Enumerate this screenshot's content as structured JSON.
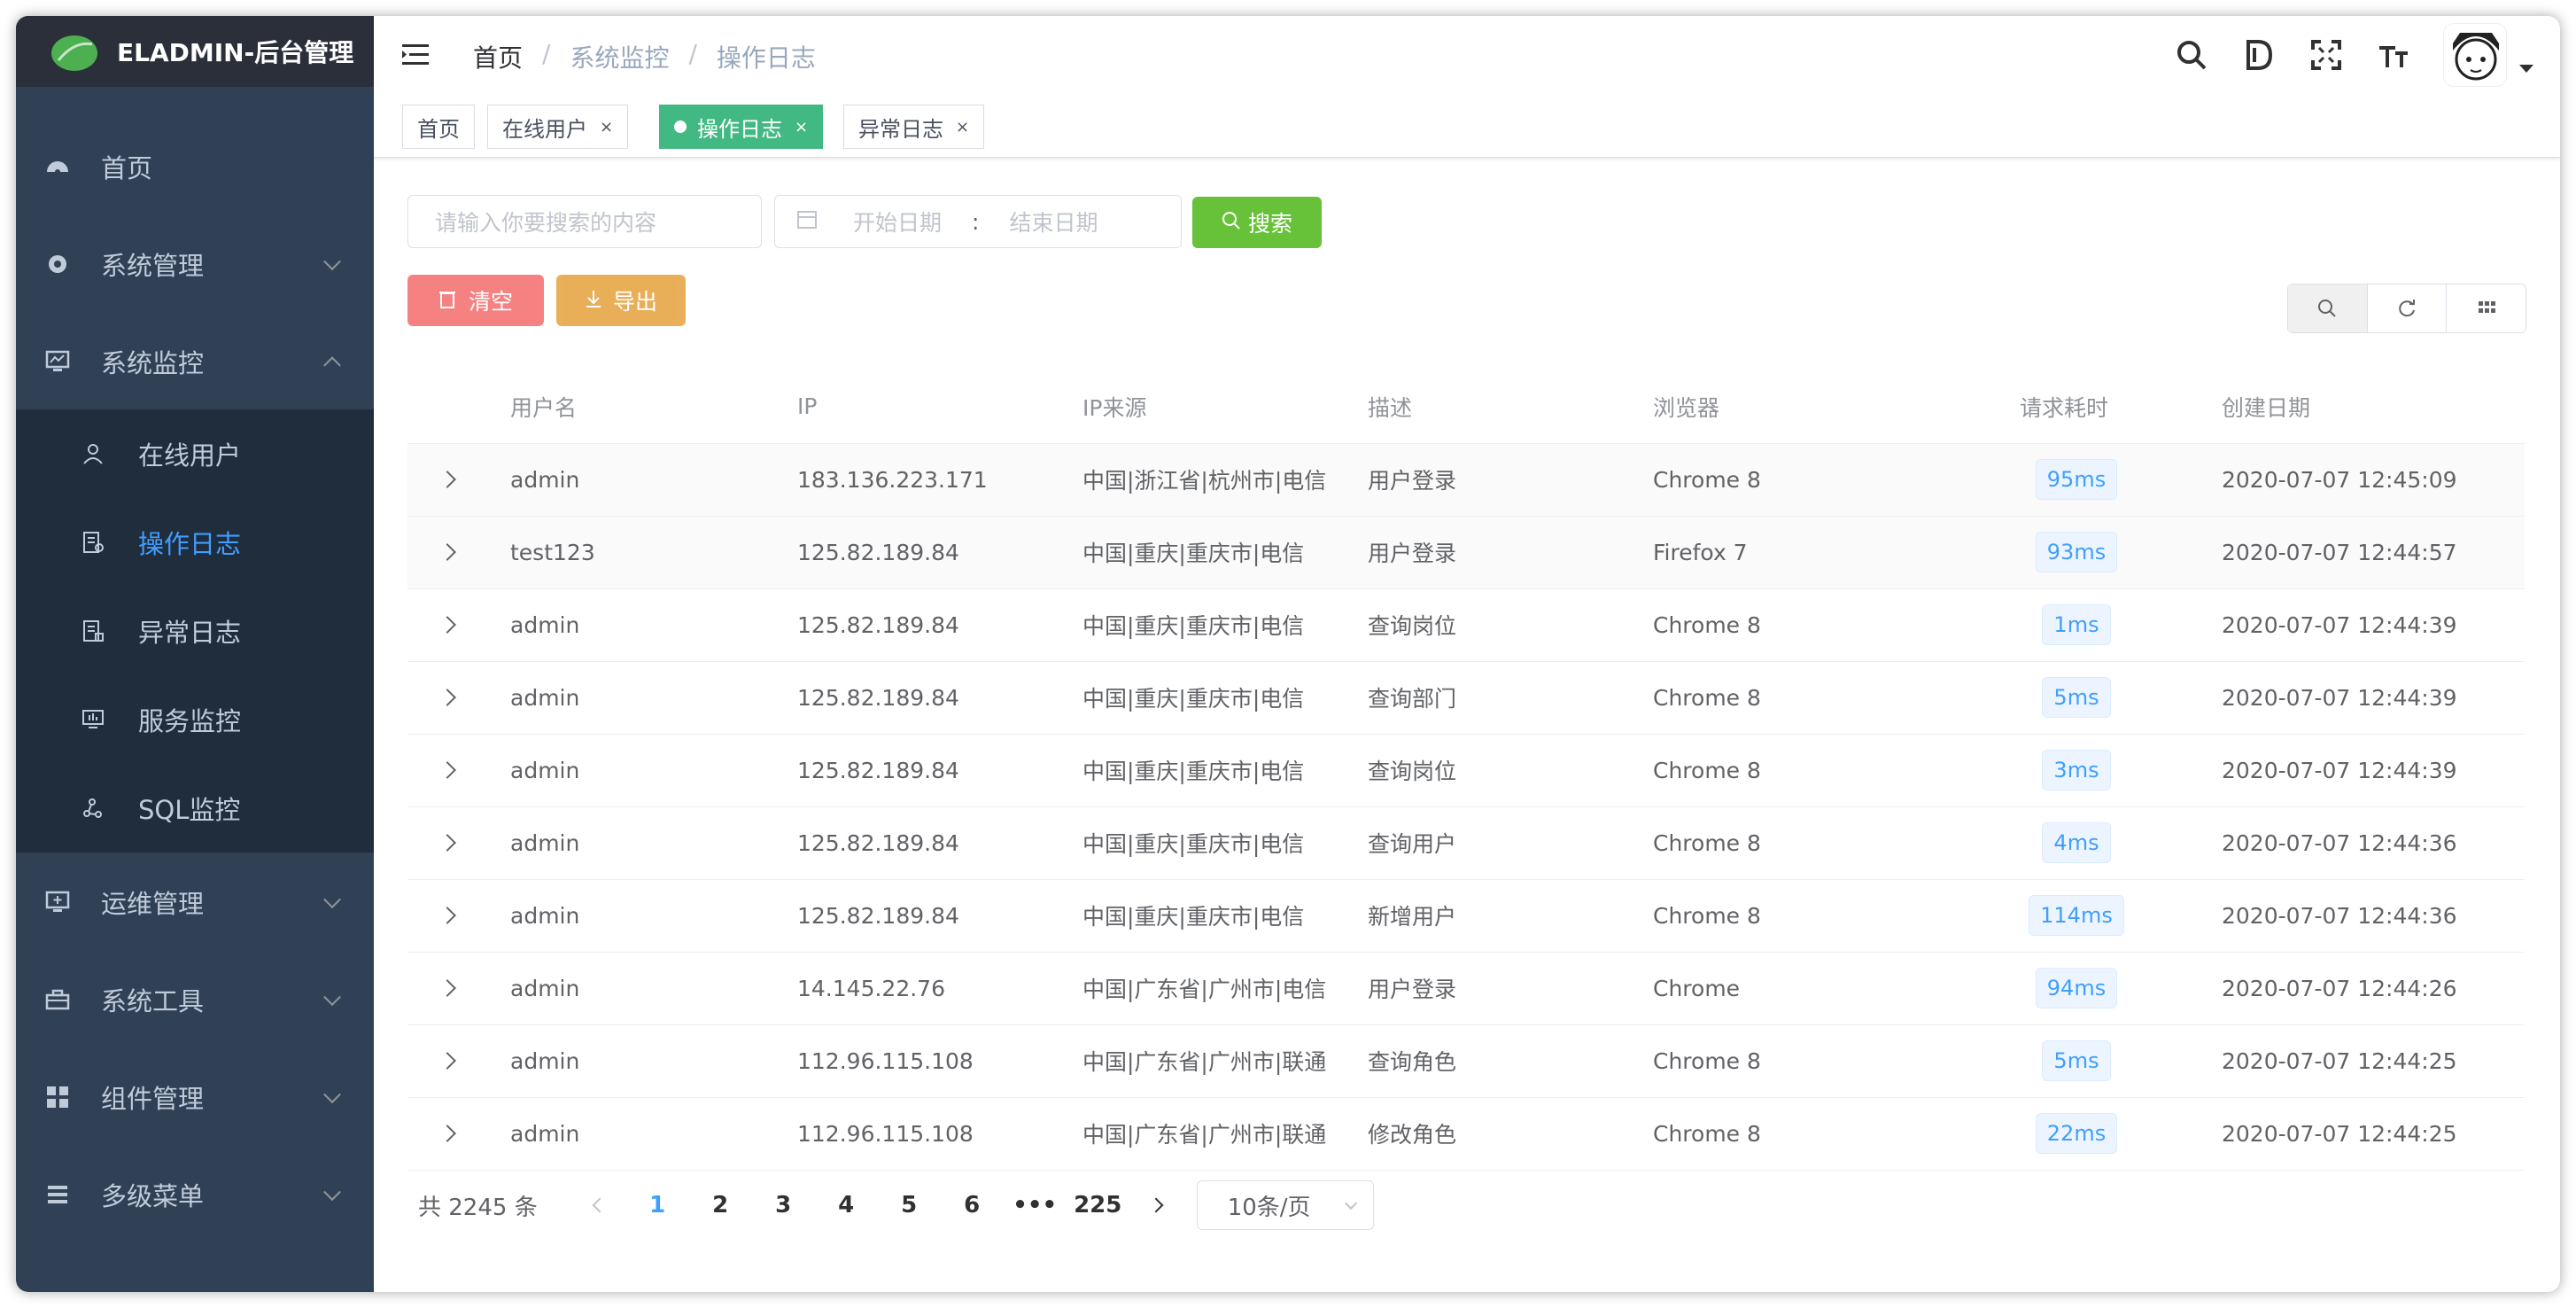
{
  "app": {
    "title": "ELADMIN-后台管理"
  },
  "sidebar": {
    "items": [
      {
        "label": "首页",
        "icon": "dashboard-icon"
      },
      {
        "label": "系统管理",
        "icon": "gear-icon"
      },
      {
        "label": "系统监控",
        "icon": "monitor-icon"
      },
      {
        "label": "运维管理",
        "icon": "ops-icon"
      },
      {
        "label": "系统工具",
        "icon": "toolbox-icon"
      },
      {
        "label": "组件管理",
        "icon": "grid-icon"
      },
      {
        "label": "多级菜单",
        "icon": "list-icon"
      }
    ],
    "submenu": [
      {
        "label": "在线用户",
        "icon": "online-user-icon"
      },
      {
        "label": "操作日志",
        "icon": "log-icon"
      },
      {
        "label": "异常日志",
        "icon": "error-log-icon"
      },
      {
        "label": "服务监控",
        "icon": "server-monitor-icon"
      },
      {
        "label": "SQL监控",
        "icon": "sql-icon"
      }
    ]
  },
  "breadcrumb": [
    "首页",
    "系统监控",
    "操作日志"
  ],
  "tags": [
    "首页",
    "在线用户",
    "操作日志",
    "异常日志"
  ],
  "filters": {
    "search_placeholder": "请输入你要搜索的内容",
    "start_placeholder": "开始日期",
    "range_sep": ":",
    "end_placeholder": "结束日期",
    "search_button": "搜索",
    "clear_button": "清空",
    "export_button": "导出"
  },
  "table": {
    "headers": [
      "用户名",
      "IP",
      "IP来源",
      "描述",
      "浏览器",
      "请求耗时",
      "创建日期"
    ],
    "rows": [
      [
        "admin",
        "183.136.223.171",
        "中国|浙江省|杭州市|电信",
        "用户登录",
        "Chrome 8",
        "95ms",
        "2020-07-07 12:45:09"
      ],
      [
        "test123",
        "125.82.189.84",
        "中国|重庆|重庆市|电信",
        "用户登录",
        "Firefox 7",
        "93ms",
        "2020-07-07 12:44:57"
      ],
      [
        "admin",
        "125.82.189.84",
        "中国|重庆|重庆市|电信",
        "查询岗位",
        "Chrome 8",
        "1ms",
        "2020-07-07 12:44:39"
      ],
      [
        "admin",
        "125.82.189.84",
        "中国|重庆|重庆市|电信",
        "查询部门",
        "Chrome 8",
        "5ms",
        "2020-07-07 12:44:39"
      ],
      [
        "admin",
        "125.82.189.84",
        "中国|重庆|重庆市|电信",
        "查询岗位",
        "Chrome 8",
        "3ms",
        "2020-07-07 12:44:39"
      ],
      [
        "admin",
        "125.82.189.84",
        "中国|重庆|重庆市|电信",
        "查询用户",
        "Chrome 8",
        "4ms",
        "2020-07-07 12:44:36"
      ],
      [
        "admin",
        "125.82.189.84",
        "中国|重庆|重庆市|电信",
        "新增用户",
        "Chrome 8",
        "114ms",
        "2020-07-07 12:44:36"
      ],
      [
        "admin",
        "14.145.22.76",
        "中国|广东省|广州市|电信",
        "用户登录",
        "Chrome",
        "94ms",
        "2020-07-07 12:44:26"
      ],
      [
        "admin",
        "112.96.115.108",
        "中国|广东省|广州市|联通",
        "查询角色",
        "Chrome 8",
        "5ms",
        "2020-07-07 12:44:25"
      ],
      [
        "admin",
        "112.96.115.108",
        "中国|广东省|广州市|联通",
        "修改角色",
        "Chrome 8",
        "22ms",
        "2020-07-07 12:44:25"
      ]
    ]
  },
  "pagination": {
    "total": "共 2245 条",
    "pages": [
      "1",
      "2",
      "3",
      "4",
      "5",
      "6",
      "•••",
      "225"
    ],
    "current": "1",
    "size": "10条/页"
  },
  "colors": {
    "sidebar": "#304156",
    "active": "#409eff",
    "tag_active": "#42b983",
    "search": "#67c23a",
    "clear": "#f56c6c",
    "export": "#e6a23c"
  }
}
